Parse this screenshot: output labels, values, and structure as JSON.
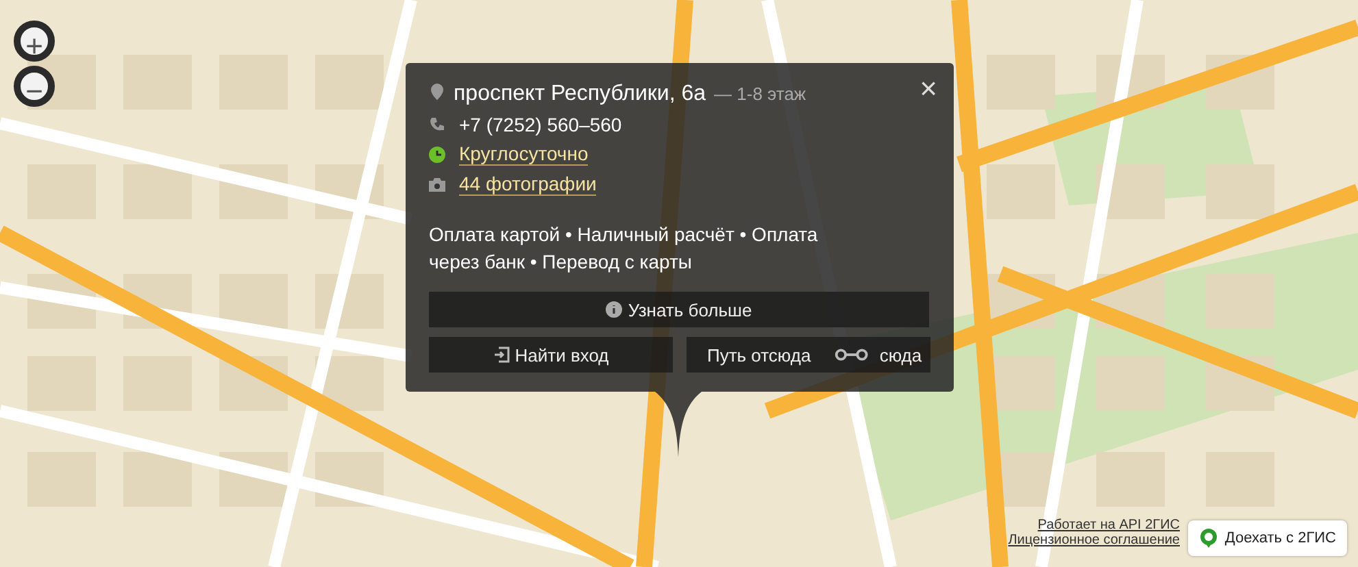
{
  "zoom_controls": [
    {
      "label": "+"
    },
    {
      "label": "−"
    }
  ],
  "popup": {
    "title": "проспект Республики, 6а",
    "subtitle": "— 1-8 этаж",
    "close": "×",
    "details": [
      {
        "kind": "phone",
        "text": "+7 (7252) 560–560"
      },
      {
        "kind": "hours",
        "text": "Круглосуточно"
      },
      {
        "kind": "photos",
        "text": "44 фотографии"
      }
    ],
    "payments": "Оплата картой • Наличный расчёт • Оплата через банк • Перевод с карты",
    "more_button": "Узнать больше",
    "entrance_button": "Найти вход",
    "route_from": "Путь отсюда",
    "route_to": "сюда"
  },
  "attribution": {
    "powered_by": "Работает на API 2ГИС",
    "license": "Лицензионное соглашение"
  },
  "open_app_button": "Доехать с 2ГИС"
}
